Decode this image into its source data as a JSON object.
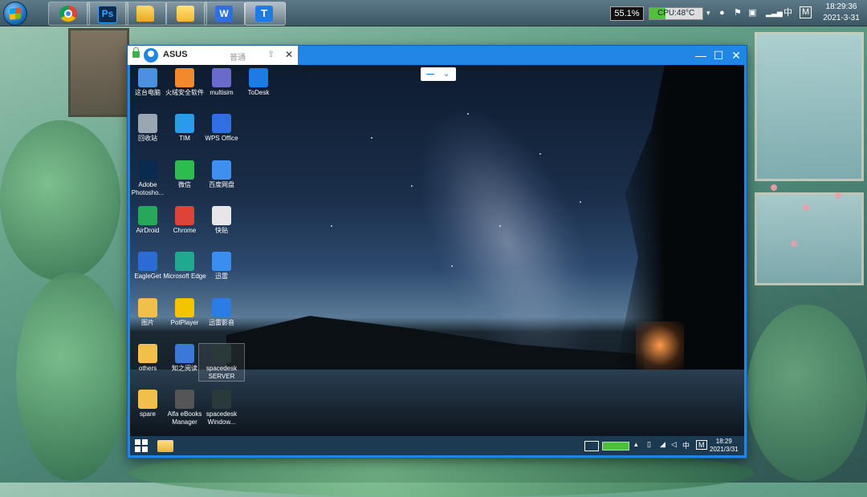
{
  "taskbar": {
    "buttons": [
      {
        "name": "chrome",
        "icon": "chrome-icon"
      },
      {
        "name": "photoshop",
        "icon": "photoshop-icon",
        "text": "Ps"
      },
      {
        "name": "folder",
        "icon": "folder-icon"
      },
      {
        "name": "notes",
        "icon": "document-icon"
      },
      {
        "name": "wps",
        "icon": "wps-icon",
        "text": "W"
      },
      {
        "name": "todesk",
        "icon": "todesk-icon",
        "text": "T"
      }
    ],
    "memory_percent": "55.1%",
    "cpu_label": "CPU:48°C",
    "cpu_level": 0.3,
    "tray_ime": "中",
    "tray_m": "M",
    "time": "18:29:36",
    "date": "2021-3-31"
  },
  "remote": {
    "tab_name": "ASUS",
    "tab_mode": "普通",
    "dropdown_value": "—",
    "desktop_icons": [
      {
        "label": "这台电脑",
        "icon": "computer-icon",
        "color": "#4a8fe0"
      },
      {
        "label": "火绒安全软件",
        "icon": "huorong-icon",
        "color": "#f08a2c"
      },
      {
        "label": "multisim",
        "icon": "multisim-icon",
        "color": "#6a6acb"
      },
      {
        "label": "ToDesk",
        "icon": "todesk-icon",
        "color": "#1e7be6"
      },
      {
        "label": "回收站",
        "icon": "recycle-bin-icon",
        "color": "#9aa7b3"
      },
      {
        "label": "TIM",
        "icon": "tim-icon",
        "color": "#2a9be8"
      },
      {
        "label": "WPS Office",
        "icon": "wps-icon",
        "color": "#2f6fe0"
      },
      {
        "label": "Adobe Photosho...",
        "icon": "photoshop-icon",
        "color": "#0b2a4f"
      },
      {
        "label": "微信",
        "icon": "wechat-icon",
        "color": "#2dbd4e"
      },
      {
        "label": "百度网盘",
        "icon": "baidu-netdisk-icon",
        "color": "#3e8ff0"
      },
      {
        "label": "AirDroid",
        "icon": "airdroid-icon",
        "color": "#26a85a"
      },
      {
        "label": "Chrome",
        "icon": "chrome-icon",
        "color": "#db4437"
      },
      {
        "label": "快贴",
        "icon": "kuaitie-icon",
        "color": "#e6e6e6"
      },
      {
        "label": "EagleGet",
        "icon": "eagleget-icon",
        "color": "#2a6bd6"
      },
      {
        "label": "Microsoft Edge",
        "icon": "edge-icon",
        "color": "#1faa8f"
      },
      {
        "label": "迅雷",
        "icon": "xunlei-icon",
        "color": "#3a8ef0"
      },
      {
        "label": "图片",
        "icon": "folder-icon",
        "color": "#f1c04a"
      },
      {
        "label": "PotPlayer",
        "icon": "potplayer-icon",
        "color": "#f2c500"
      },
      {
        "label": "迅雷影音",
        "icon": "xunlei-player-icon",
        "color": "#2b7de6"
      },
      {
        "label": "others",
        "icon": "folder-icon",
        "color": "#f1c04a"
      },
      {
        "label": "知之阅读",
        "icon": "zhizhi-reader-icon",
        "color": "#3b78d8"
      },
      {
        "label": "spacedesk SERVER",
        "icon": "spacedesk-icon",
        "color": "#2a3a3a"
      },
      {
        "label": "spare",
        "icon": "folder-icon",
        "color": "#f1c04a"
      },
      {
        "label": "Alfa eBooks Manager",
        "icon": "alfa-ebooks-icon",
        "color": "#555"
      },
      {
        "label": "spacedesk Window...",
        "icon": "spacedesk-icon",
        "color": "#2a3a3a"
      }
    ],
    "taskbar": {
      "tray_ime": "中",
      "tray_m": "M",
      "time": "18:29",
      "date": "2021/3/31"
    }
  }
}
